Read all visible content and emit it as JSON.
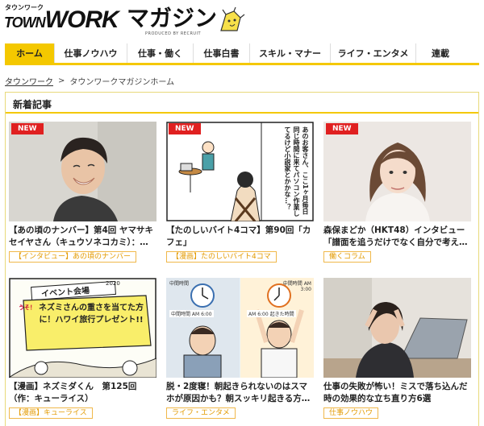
{
  "header": {
    "logo_small": "タウンワーク",
    "logo_town": "TOWN",
    "logo_work": "WORK",
    "logo_magazine": "マガジン",
    "logo_recruit": "PRODUCED BY RECRUIT"
  },
  "nav": {
    "items": [
      {
        "label": "ホーム",
        "active": true
      },
      {
        "label": "仕事ノウハウ",
        "active": false
      },
      {
        "label": "仕事・働く",
        "active": false
      },
      {
        "label": "仕事白書",
        "active": false
      },
      {
        "label": "スキル・マナー",
        "active": false
      },
      {
        "label": "ライフ・エンタメ",
        "active": false
      },
      {
        "label": "連載",
        "active": false
      }
    ]
  },
  "breadcrumb": {
    "home": "タウンワーク",
    "separator": ">",
    "current": "タウンワークマガジンホーム"
  },
  "section": {
    "title": "新着記事"
  },
  "articles": [
    {
      "new_badge": "NEW",
      "title": "【あの頃のナンバー】第4回 ヤマサキセイヤさん（キュウソネコカミ）：…",
      "tag": "【インタビュー】あの頃のナンバー"
    },
    {
      "new_badge": "NEW",
      "title": "【たのしいバイト4コマ】第90回「カフェ」",
      "tag": "【漫画】たのしいバイト4コマ",
      "comic_text": "あのお客さん、ここ1ヶ月毎日同じ時間に来てパソコン作業してるけど小説家とかかな…？"
    },
    {
      "new_badge": "NEW",
      "title": "森保まどか（HKT48）インタビュー「譜面を追うだけでなく自分で考え…",
      "tag": "働くコラム"
    },
    {
      "new_badge": "",
      "title": "【漫画】ネズミダくん　第125回（作：キューライス）",
      "tag": "【漫画】キューライス",
      "comic_year": "2020",
      "comic_sign": "イベント会場",
      "comic_bubble": "ネズミさんの重さを当てた方に！ハワイ旅行プレゼント!!",
      "comic_yes": "うそ！"
    },
    {
      "new_badge": "",
      "title": "脱・2度寝！朝起きられないのはスマホが原因かも？朝スッキリ起きる方…",
      "tag": "ライフ・エンタメ",
      "clock_left_top": "中間時間",
      "clock_left_bottom": "中間時間 AM 6:00",
      "clock_right_top": "中間時間 AM 3:00",
      "clock_right_bottom": "AM 6:00 起きた時間"
    },
    {
      "new_badge": "",
      "title": "仕事の失敗が怖い！ミスで落ち込んだ時の効果的な立ち直り方6選",
      "tag": "仕事ノウハウ"
    }
  ]
}
